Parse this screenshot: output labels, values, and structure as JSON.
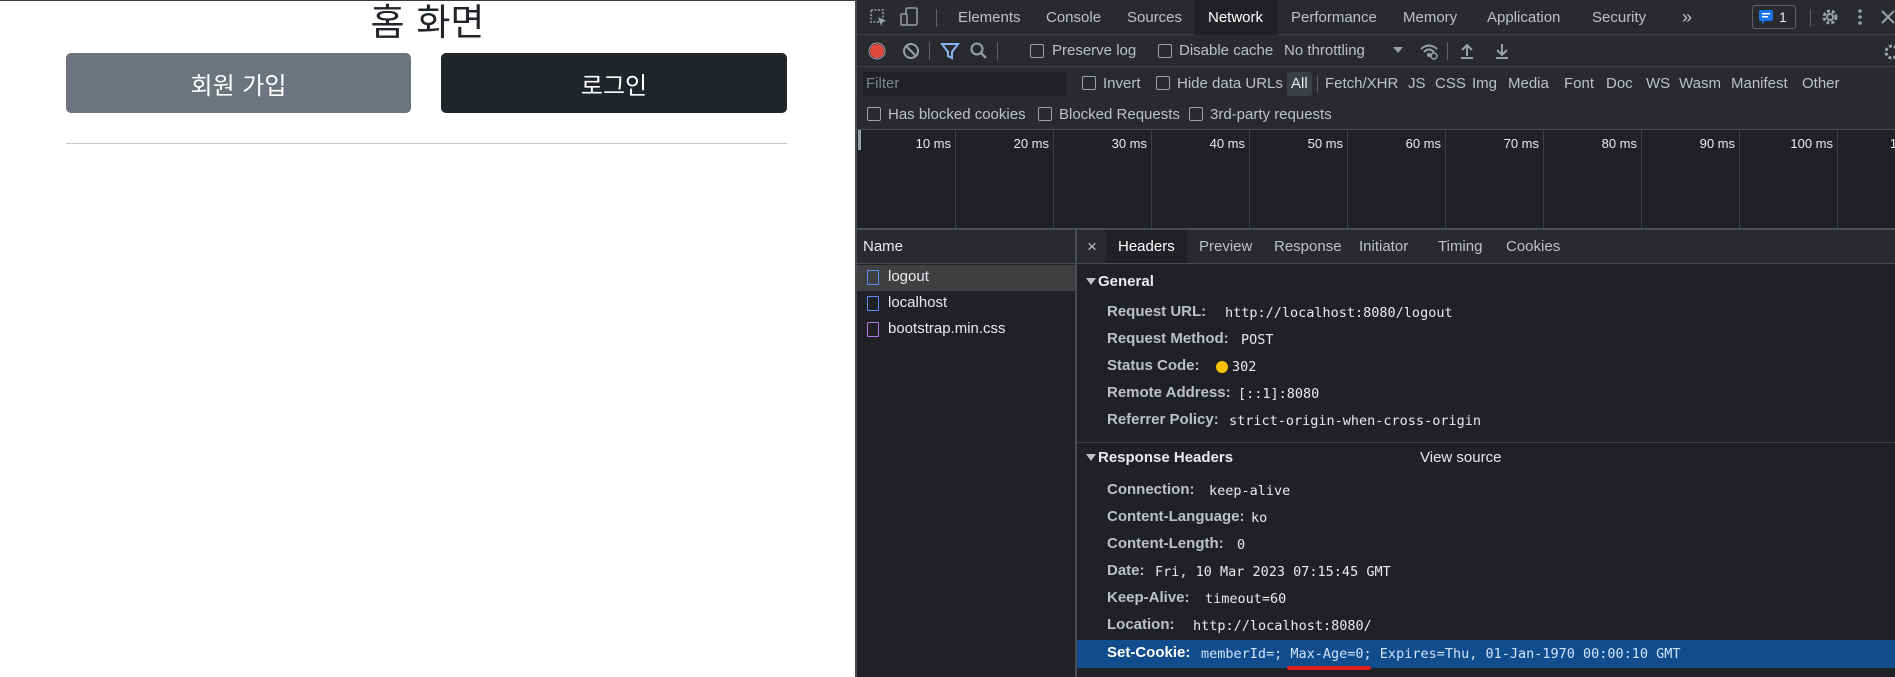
{
  "page": {
    "title": "홈 화면",
    "signup_label": "회원 가입",
    "login_label": "로그인"
  },
  "devtools": {
    "main_tabs": [
      "Elements",
      "Console",
      "Sources",
      "Network",
      "Performance",
      "Memory",
      "Application",
      "Security"
    ],
    "more_tabs": "»",
    "issues_count": "1",
    "network_toolbar": {
      "preserve_log": "Preserve log",
      "disable_cache": "Disable cache",
      "throttling": "No throttling"
    },
    "filter": {
      "placeholder": "Filter",
      "invert": "Invert",
      "hide_data_urls": "Hide data URLs",
      "types": [
        "All",
        "Fetch/XHR",
        "JS",
        "CSS",
        "Img",
        "Media",
        "Font",
        "Doc",
        "WS",
        "Wasm",
        "Manifest",
        "Other"
      ]
    },
    "blocked": {
      "has_blocked_cookies": "Has blocked cookies",
      "blocked_requests": "Blocked Requests",
      "third_party": "3rd-party requests"
    },
    "timeline_ticks": [
      "10 ms",
      "20 ms",
      "30 ms",
      "40 ms",
      "50 ms",
      "60 ms",
      "70 ms",
      "80 ms",
      "90 ms",
      "100 ms",
      "1"
    ],
    "name_header": "Name",
    "requests": [
      {
        "name": "logout",
        "type": "doc"
      },
      {
        "name": "localhost",
        "type": "doc"
      },
      {
        "name": "bootstrap.min.css",
        "type": "css"
      }
    ],
    "detail_tabs": [
      "Headers",
      "Preview",
      "Response",
      "Initiator",
      "Timing",
      "Cookies"
    ],
    "close": "×",
    "general": {
      "title": "General",
      "rows": [
        {
          "key": "Request URL:",
          "value": "http://localhost:8080/logout"
        },
        {
          "key": "Request Method:",
          "value": "POST"
        },
        {
          "key": "Status Code:",
          "value": "302"
        },
        {
          "key": "Remote Address:",
          "value": "[::1]:8080"
        },
        {
          "key": "Referrer Policy:",
          "value": "strict-origin-when-cross-origin"
        }
      ]
    },
    "response_headers": {
      "title": "Response Headers",
      "view_source": "View source",
      "rows": [
        {
          "key": "Connection:",
          "value": "keep-alive"
        },
        {
          "key": "Content-Language:",
          "value": "ko"
        },
        {
          "key": "Content-Length:",
          "value": "0"
        },
        {
          "key": "Date:",
          "value": "Fri, 10 Mar 2023 07:15:45 GMT"
        },
        {
          "key": "Keep-Alive:",
          "value": "timeout=60"
        },
        {
          "key": "Location:",
          "value": "http://localhost:8080/"
        },
        {
          "key": "Set-Cookie:",
          "value": "memberId=; Max-Age=0; Expires=Thu, 01-Jan-1970 00:00:10 GMT"
        }
      ]
    },
    "colors": {
      "record": "#e0483e",
      "status_dot": "#f7c300",
      "highlight_row": "#114d8c",
      "underline": "#e0201f",
      "accent": "#8ab4f8"
    }
  }
}
